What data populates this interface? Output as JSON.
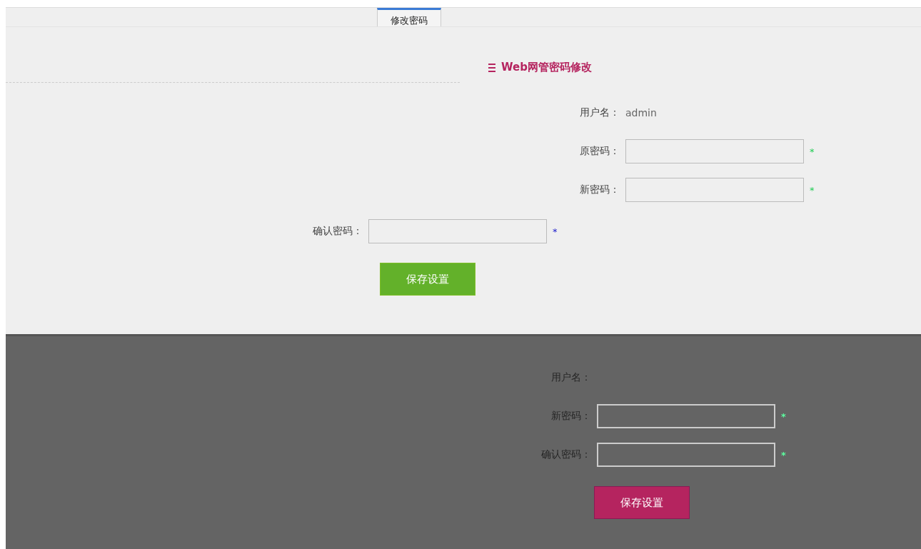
{
  "tabs": [
    {
      "label": "修改密码",
      "selected": true
    }
  ],
  "section_title": "Web网管密码修改",
  "form": {
    "username_label": "用户名：",
    "username": "admin",
    "fields": [
      {
        "label": "原密码：",
        "required_mark": "*"
      },
      {
        "label": "新密码：",
        "required_mark": "*"
      },
      {
        "label": "确认密码：",
        "required_mark": "*"
      }
    ],
    "save_button": "保存设置"
  },
  "lower_form": {
    "username_label": "用户名：",
    "fields": [
      {
        "label": "新密码：",
        "required_mark": "*"
      },
      {
        "label": "确认密码：",
        "required_mark": "*"
      }
    ],
    "save_button": "保存设置"
  }
}
